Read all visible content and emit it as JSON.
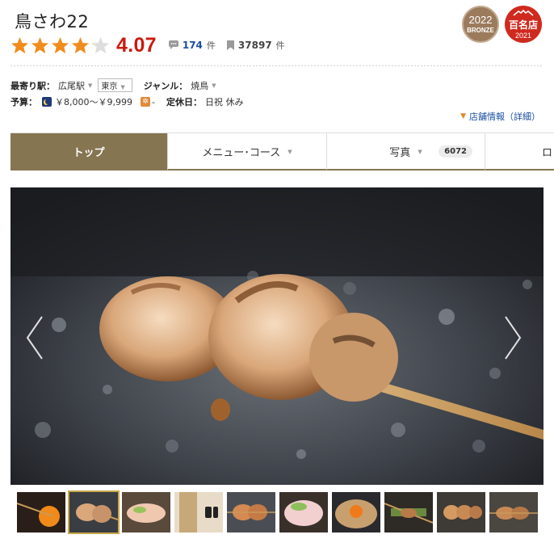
{
  "shop": {
    "name": "鳥さわ22",
    "score": "4.07",
    "rating_stars": 4.07,
    "reviews_count": "174",
    "reviews_unit": "件",
    "saves_count": "37897",
    "saves_unit": "件"
  },
  "badges": {
    "bronze_year": "2022",
    "bronze_label": "BRONZE",
    "hyakumeiten_label": "百名店",
    "hyakumeiten_year": "2021"
  },
  "info": {
    "station_label": "最寄り駅：",
    "station_value": "広尾駅",
    "area_value": "東京",
    "genre_label": "ジャンル：",
    "genre_value": "焼鳥",
    "budget_label": "予算：",
    "dinner_budget": "￥8,000～￥9,999",
    "lunch_budget": "-",
    "holiday_label": "定休日：",
    "holiday_value": "日祝 休み",
    "detail_link": "店舗情報（詳細）"
  },
  "tabs": [
    {
      "label": "トップ",
      "active": true
    },
    {
      "label": "メニュー･コース",
      "active": false
    },
    {
      "label": "写真",
      "count": "6072",
      "active": false
    },
    {
      "label": "ロ",
      "active": false
    }
  ],
  "icons": {
    "star": "star-icon",
    "review": "speech-bubble-icon",
    "save": "bookmark-icon",
    "moon": "moon-icon",
    "sun": "sun-icon",
    "chevron": "chevron-down-icon",
    "prev": "chevron-left-icon",
    "next": "chevron-right-icon"
  },
  "colors": {
    "score": "#cc1a0e",
    "star": "#f08c1c",
    "active_tab": "#857551",
    "link": "#1a4fa0",
    "bronze": "#9b7b5c",
    "hyakumeiten": "#cf2a1e"
  },
  "gallery": {
    "thumbnail_count": 10,
    "selected_index": 1
  }
}
